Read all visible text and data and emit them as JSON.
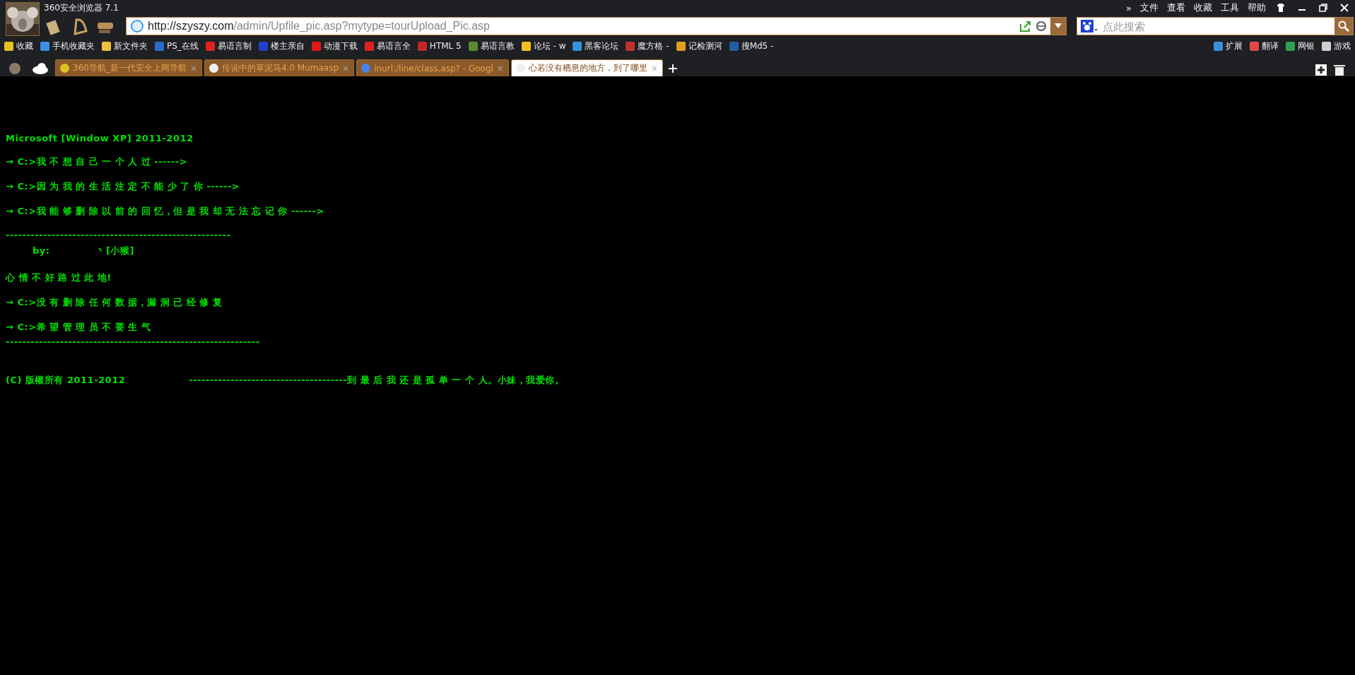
{
  "window": {
    "title": "360安全浏览器 7.1"
  },
  "menu": [
    {
      "label": "»"
    },
    {
      "label": "文件"
    },
    {
      "label": "查看"
    },
    {
      "label": "收藏"
    },
    {
      "label": "工具"
    },
    {
      "label": "帮助"
    }
  ],
  "address": {
    "host": "http://szyszy.com",
    "path": "/admin/Upfile_pic.asp?mytype=tourUpload_Pic.asp"
  },
  "search": {
    "placeholder": "点此搜索"
  },
  "bookmarks": [
    {
      "label": "收藏",
      "color": "#e8c020"
    },
    {
      "label": "手机收藏夹",
      "color": "#3a8ee8"
    },
    {
      "label": "新文件夹",
      "color": "#f0c040"
    },
    {
      "label": "PS_在线",
      "color": "#2a6ad0"
    },
    {
      "label": "易语言制",
      "color": "#e02020"
    },
    {
      "label": "楼主亲自",
      "color": "#2040d0"
    },
    {
      "label": "动漫下载",
      "color": "#e01818"
    },
    {
      "label": "易语言全",
      "color": "#e02020"
    },
    {
      "label": "HTML 5",
      "color": "#c02828"
    },
    {
      "label": "易语言教",
      "color": "#5a8a30"
    },
    {
      "label": "论坛 - w",
      "color": "#f0c020"
    },
    {
      "label": "黑客论坛",
      "color": "#3a90d8"
    },
    {
      "label": "魔方格 -",
      "color": "#c03030"
    },
    {
      "label": "记检测河",
      "color": "#e0a020"
    },
    {
      "label": "搜Md5 -",
      "color": "#2060a0"
    }
  ],
  "right_tools": [
    {
      "label": "扩展",
      "color": "#3a90d8"
    },
    {
      "label": "翻译",
      "color": "#e04848"
    },
    {
      "label": "网银",
      "color": "#30a050"
    },
    {
      "label": "游戏",
      "color": "#d0d0d0"
    }
  ],
  "tabs": [
    {
      "label": "360导航_新一代安全上网导航",
      "close": "×",
      "selected": false,
      "color": "#e0c020"
    },
    {
      "label": "传说中的草泥马4.0 Mumaasp",
      "close": "×",
      "selected": false,
      "color": "#f0f0f0"
    },
    {
      "label": "inurl:/line/class.asp? - Googl",
      "close": "×",
      "selected": false,
      "color": "#4a80e8"
    },
    {
      "label": "心若没有栖息的地方，到了哪里",
      "close": "×",
      "selected": true,
      "color": "#f0f0f0"
    }
  ],
  "page_lines": [
    {
      "kind": "text",
      "text": "Microsoft [Window XP] 2011-2012"
    },
    {
      "kind": "text",
      "text": "→ C:>我 不 想 自 己 一 个 人 过 ------>"
    },
    {
      "kind": "text",
      "text": "→ C:>因 为 我 的 生 活 注 定 不 能 少 了 你 ------>"
    },
    {
      "kind": "text",
      "text": "→ C:>我 能 够 删 除 以 前 的 回 忆，但 是 我 却 无 法 忘 记 你 ------>"
    },
    {
      "kind": "rule",
      "text": "------------------------------------------------------"
    },
    {
      "kind": "by",
      "text": "by:",
      "name": "丶[小猴]"
    },
    {
      "kind": "text",
      "text": "心 情 不 好 路 过 此 地!"
    },
    {
      "kind": "text",
      "text": "→ C:>没 有 删 除 任 何 数 据，漏 洞 已 经 修 复"
    },
    {
      "kind": "text",
      "text": "→ C:>希 望 管 理 员 不 要 生 气"
    },
    {
      "kind": "rule",
      "text": "-------------------------------------------------------------"
    },
    {
      "kind": "footer",
      "text": "(C) 版權所有 2011-2012",
      "tail": "--------------------------------------到 最 后 我 还 是 孤 单 一 个 人。小妹，我爱你。"
    }
  ]
}
